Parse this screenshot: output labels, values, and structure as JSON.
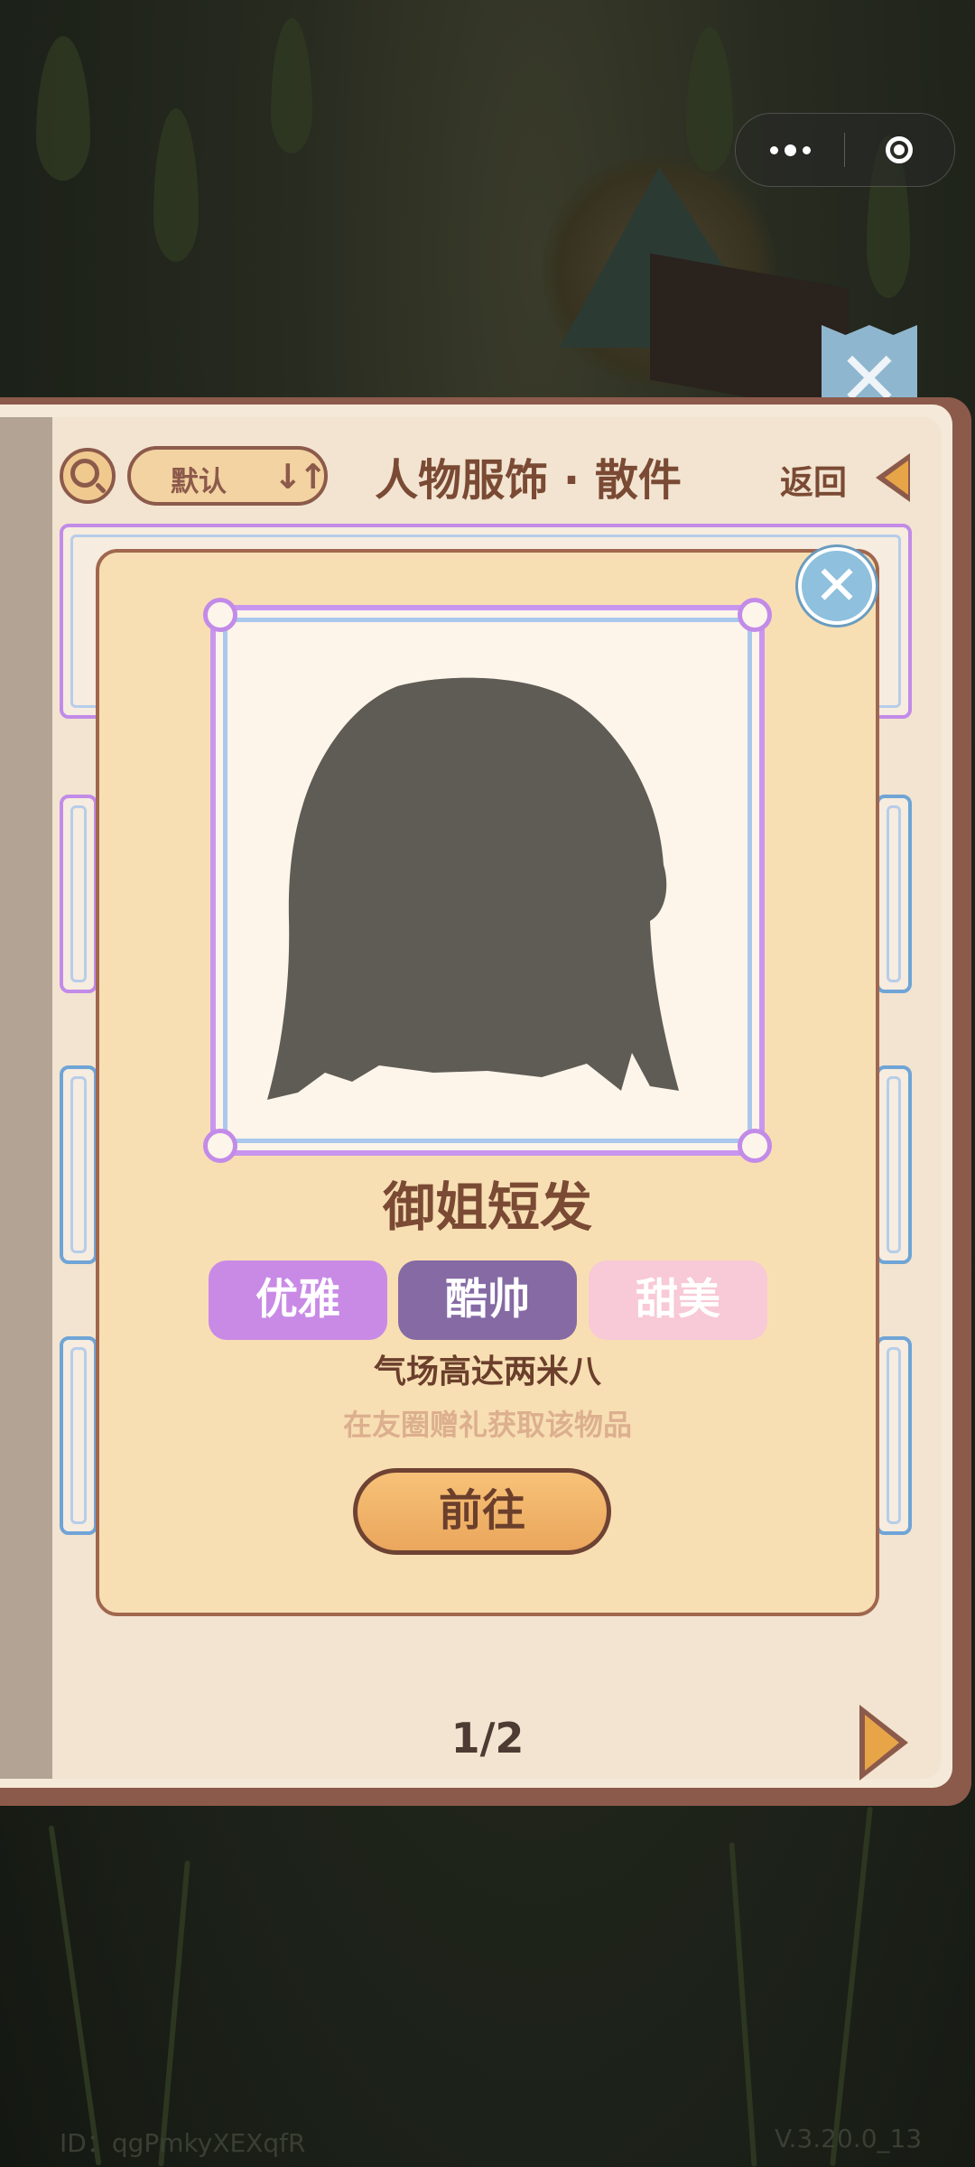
{
  "header": {
    "sort_label": "默认",
    "sort_icon": "sort-arrows-icon",
    "title": "人物服饰 · 散件",
    "back_label": "返回"
  },
  "modal": {
    "item_name": "御姐短发",
    "tags": [
      {
        "label": "优雅",
        "color": "#c98ae6"
      },
      {
        "label": "酷帅",
        "color": "#856aa4"
      },
      {
        "label": "甜美",
        "color": "#f8c9d6"
      }
    ],
    "description": "气场高达两米八",
    "hint": "在友圈赠礼获取该物品",
    "go_button": "前往",
    "close_icon": "close-icon"
  },
  "pager": {
    "text": "1/2"
  },
  "footer": {
    "id_text": "ID：qgPmkyXEXqfR",
    "version": "V.3.20.0_13"
  },
  "colors": {
    "book_border": "#8c5a4b",
    "modal_bg": "#f8dfb3",
    "accent_orange": "#e8a548"
  }
}
